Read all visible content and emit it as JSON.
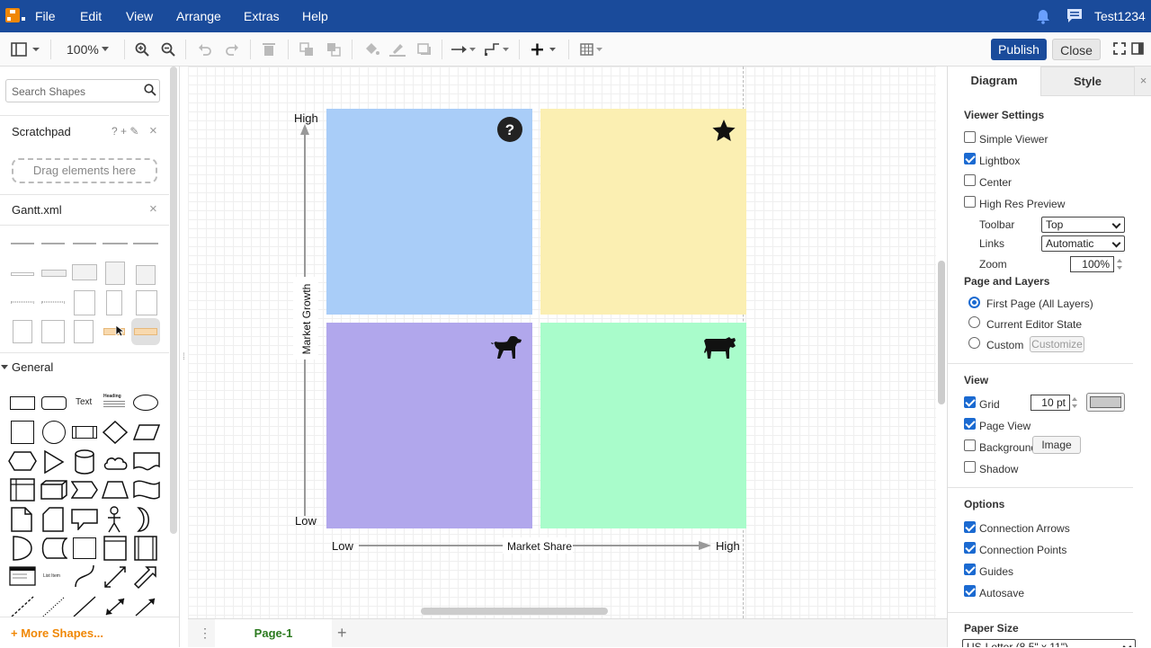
{
  "menubar": {
    "items": [
      "File",
      "Edit",
      "View",
      "Arrange",
      "Extras",
      "Help"
    ],
    "user": "Test1234"
  },
  "toolbar": {
    "zoom": "100%",
    "publish": "Publish",
    "close": "Close"
  },
  "left_panel": {
    "search_placeholder": "Search Shapes",
    "scratchpad": "Scratchpad",
    "scratchpad_controls": "? + ✎",
    "drag_hint": "Drag elements here",
    "gantt": "Gantt.xml",
    "general": "General",
    "shape_text": "Text",
    "shape_heading": "Heading",
    "shape_list_item": "List Item",
    "more_shapes": "+ More Shapes..."
  },
  "diagram": {
    "y_axis": {
      "title": "Market Growth",
      "high": "High",
      "low": "Low"
    },
    "x_axis": {
      "title": "Market Share",
      "low": "Low",
      "high": "High"
    },
    "quadrants": [
      {
        "name": "question-mark",
        "color": "#a9cdf8",
        "icon": "question-icon"
      },
      {
        "name": "star",
        "color": "#fbefb2",
        "icon": "star-icon"
      },
      {
        "name": "dog",
        "color": "#b1a7ec",
        "icon": "dog-icon"
      },
      {
        "name": "cow",
        "color": "#a9fccb",
        "icon": "cow-icon"
      }
    ]
  },
  "page_tab": "Page-1",
  "right_panel": {
    "tabs": [
      "Diagram",
      "Style"
    ],
    "viewer_settings": "Viewer Settings",
    "simple_viewer": "Simple Viewer",
    "lightbox": "Lightbox",
    "center": "Center",
    "high_res": "High Res Preview",
    "toolbar_label": "Toolbar",
    "toolbar_value": "Top",
    "links_label": "Links",
    "links_value": "Automatic",
    "zoom_label": "Zoom",
    "zoom_value": "100%",
    "page_layers": "Page and Layers",
    "first_page": "First Page (All Layers)",
    "current_state": "Current Editor State",
    "custom": "Custom",
    "customize": "Customize",
    "view": "View",
    "grid": "Grid",
    "grid_size": "10 pt",
    "grid_color": "#c8c8c8",
    "page_view": "Page View",
    "background": "Background",
    "image_btn": "Image",
    "shadow": "Shadow",
    "options": "Options",
    "connection_arrows": "Connection Arrows",
    "connection_points": "Connection Points",
    "guides": "Guides",
    "autosave": "Autosave",
    "paper_size": "Paper Size",
    "paper_value": "US-Letter (8.5\" x 11\")"
  }
}
